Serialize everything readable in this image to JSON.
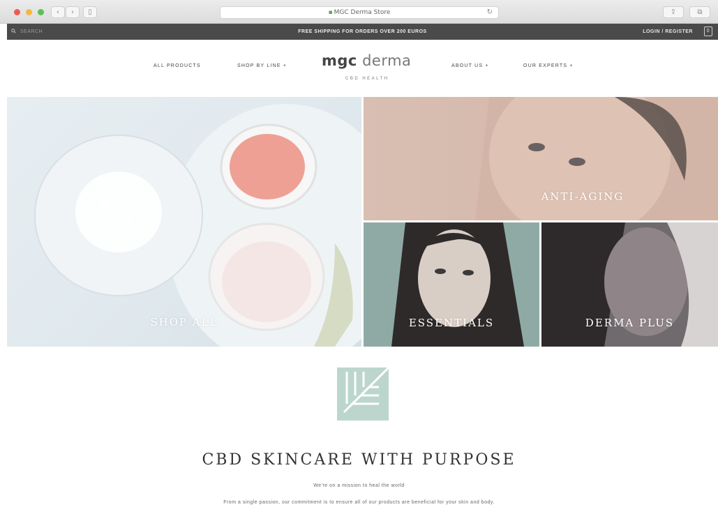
{
  "browser": {
    "url": "MGC Derma Store",
    "icons": [
      "back-icon",
      "forward-icon",
      "sidebar-icon",
      "reload-icon",
      "share-icon",
      "tabs-icon"
    ]
  },
  "announcement": {
    "search_label": "SEARCH",
    "promo_text": "FREE SHIPPING FOR ORDERS OVER 200 EUROS",
    "login_label": "LOGIN / REGISTER",
    "cart_count": "0"
  },
  "nav": {
    "left": [
      "ALL PRODUCTS",
      "SHOP BY LINE +"
    ],
    "right": [
      "ABOUT US +",
      "OUR EXPERTS +"
    ],
    "logo_bold": "mgc",
    "logo_light": "derma",
    "logo_sub": "CBD HEALTH"
  },
  "tiles": {
    "shop_all": "SHOP ALL",
    "anti_aging": "ANTI-AGING",
    "essentials": "ESSENTIALS",
    "derma_plus": "DERMA PLUS"
  },
  "content": {
    "headline": "CBD SKINCARE WITH PURPOSE",
    "subline": "We're on a mission to heal the world",
    "body": "From a single passion, our commitment is to ensure all of our products are beneficial for your skin and body."
  },
  "colors": {
    "accent_leaf": "#bcd6cd",
    "topbar": "#4a4a4a"
  }
}
